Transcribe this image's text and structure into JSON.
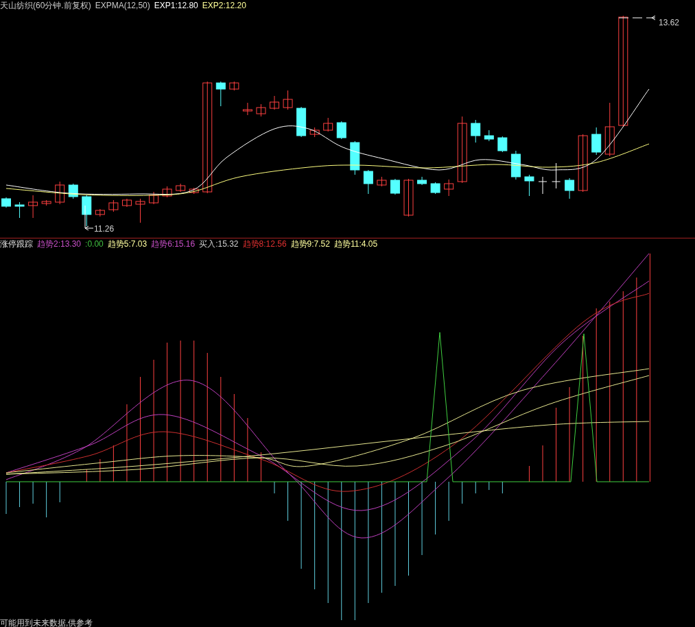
{
  "price_panel": {
    "header": [
      {
        "text": "天山纺织(60分钟.前复权)",
        "color": "#c8c8c8"
      },
      {
        "text": "EXPMA(12,50)",
        "color": "#c8c8c8"
      },
      {
        "text": "EXP1:12.80",
        "color": "#ffffff"
      },
      {
        "text": "EXP2:12.20",
        "color": "#ffff99"
      }
    ],
    "high_label": "13.62",
    "low_label": "11.26"
  },
  "indicator_panel": {
    "title": "涨停跟踪",
    "legend": [
      {
        "text": "趋势2:13.30",
        "color": "#c850c8"
      },
      {
        "text": ":0.00",
        "color": "#40c040"
      },
      {
        "text": "趋势5:7.03",
        "color": "#ffffa0"
      },
      {
        "text": "趋势6:15.16",
        "color": "#c850c8"
      },
      {
        "text": "买入:15.32",
        "color": "#d0d0d0"
      },
      {
        "text": "趋势8:12.56",
        "color": "#e03030"
      },
      {
        "text": "趋势9:7.52",
        "color": "#ffffa0"
      },
      {
        "text": "趋势11:4.05",
        "color": "#ffffa0"
      }
    ],
    "note": "可能用到未来数据,供参考"
  }
}
